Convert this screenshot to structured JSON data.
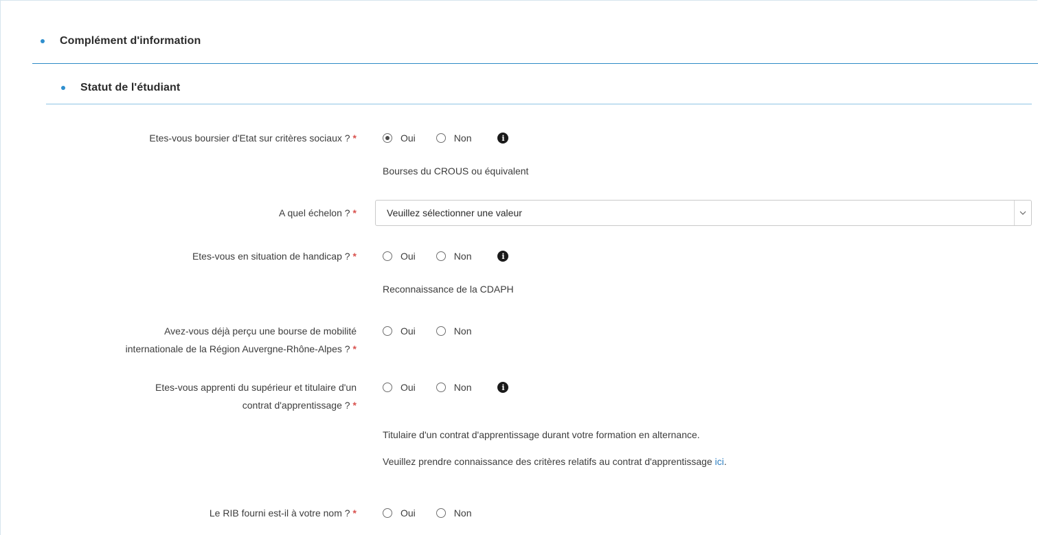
{
  "section": {
    "title": "Complément d'information",
    "subsection_title": "Statut de l'étudiant"
  },
  "required_marker": "*",
  "options": {
    "yes": "Oui",
    "no": "Non"
  },
  "fields": {
    "boursier": {
      "label": "Etes-vous boursier d'Etat sur critères sociaux ?",
      "selected": "Oui",
      "help": "Bourses du CROUS ou équivalent"
    },
    "echelon": {
      "label": "A quel échelon ?",
      "select_value": "Veuillez sélectionner une valeur"
    },
    "handicap": {
      "label": "Etes-vous en situation de handicap ?",
      "help": "Reconnaissance de la CDAPH"
    },
    "mobilite": {
      "label_line1": "Avez-vous déjà perçu une bourse de mobilité",
      "label_line2": "internationale de la Région Auvergne-Rhône-Alpes ?"
    },
    "apprenti": {
      "label_line1": "Etes-vous apprenti du supérieur et titulaire d'un",
      "label_line2": "contrat d'apprentissage ?",
      "help1": "Titulaire d'un contrat d'apprentissage durant votre formation en alternance.",
      "help2_prefix": "Veuillez prendre connaissance des critères relatifs au contrat d'apprentissage ",
      "help2_link": "ici",
      "help2_suffix": "."
    },
    "rib": {
      "label": "Le RIB fourni est-il à votre nom ?"
    }
  },
  "colors": {
    "accent": "#2b8ac6",
    "required": "#d9534f",
    "link": "#2f7fc1"
  },
  "icons": {
    "info": "info-circle-icon",
    "select_arrow": "chevron-down-icon"
  }
}
